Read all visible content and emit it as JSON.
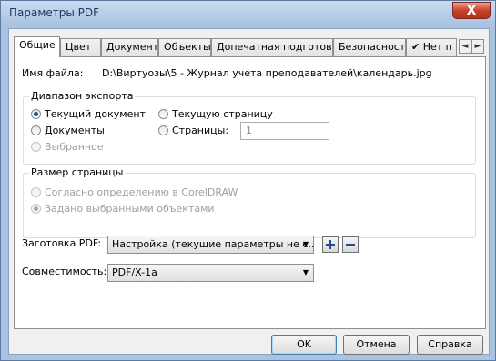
{
  "window": {
    "title": "Параметры PDF",
    "close_label": "X"
  },
  "tabs": [
    {
      "label": "Общие",
      "active": true
    },
    {
      "label": "Цвет"
    },
    {
      "label": "Документ"
    },
    {
      "label": "Объекты"
    },
    {
      "label": "Допечатная подготовка"
    },
    {
      "label": "Безопасность"
    },
    {
      "label": "Нет п"
    }
  ],
  "tab_scroll": {
    "left": "◄",
    "right": "►"
  },
  "file": {
    "label": "Имя файла:",
    "value": "D:\\Виртуозы\\5 - Журнал учета преподавателей\\календарь.jpg"
  },
  "export_range": {
    "title": "Диапазон экспорта",
    "current_document": "Текущий документ",
    "documents": "Документы",
    "selected": "Выбранное",
    "current_page": "Текущую страницу",
    "pages": "Страницы:",
    "pages_value": "1"
  },
  "page_size": {
    "title": "Размер страницы",
    "as_defined": "Согласно определению в CorelDRAW",
    "by_selected": "Задано выбранными объектами"
  },
  "preset": {
    "label": "Заготовка PDF:",
    "value": "Настройка (текущие параметры не с..."
  },
  "compatibility": {
    "label": "Совместимость:",
    "value": "PDF/X-1a"
  },
  "buttons": {
    "ok": "OK",
    "cancel": "Отмена",
    "help": "Справка"
  }
}
